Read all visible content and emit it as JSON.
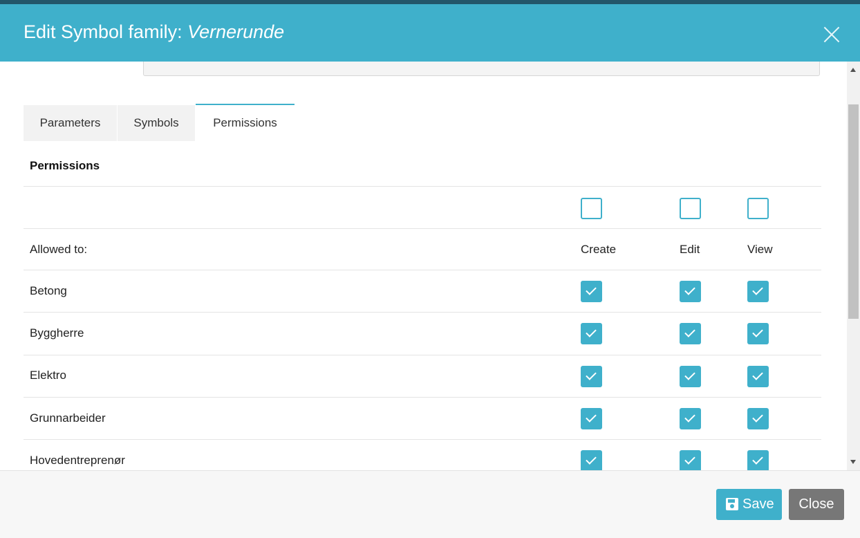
{
  "header": {
    "title_prefix": "Edit Symbol family:",
    "title_name": "Vernerunde"
  },
  "tabs": [
    {
      "label": "Parameters",
      "active": false
    },
    {
      "label": "Symbols",
      "active": false
    },
    {
      "label": "Permissions",
      "active": true
    }
  ],
  "permissions": {
    "section_title": "Permissions",
    "allowed_label": "Allowed to:",
    "columns": [
      "Create",
      "Edit",
      "View"
    ],
    "select_all": {
      "create": false,
      "edit": false,
      "view": false
    },
    "rows": [
      {
        "name": "Betong",
        "create": true,
        "edit": true,
        "view": true
      },
      {
        "name": "Byggherre",
        "create": true,
        "edit": true,
        "view": true
      },
      {
        "name": "Elektro",
        "create": true,
        "edit": true,
        "view": true
      },
      {
        "name": "Grunnarbeider",
        "create": true,
        "edit": true,
        "view": true
      },
      {
        "name": "Hovedentreprenør",
        "create": true,
        "edit": true,
        "view": true
      }
    ]
  },
  "footer": {
    "save_label": "Save",
    "close_label": "Close"
  },
  "colors": {
    "accent": "#3fb0cb",
    "close_button": "#777777"
  },
  "icons": {
    "close": "close-icon",
    "save": "floppy-disk-icon",
    "check": "checkmark-icon"
  }
}
